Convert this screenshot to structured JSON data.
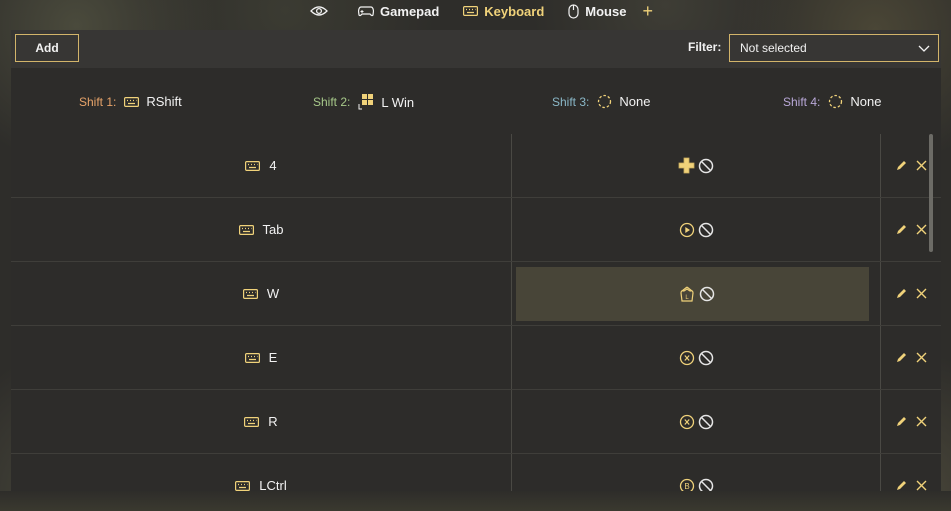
{
  "tabs": {
    "items": [
      {
        "label": "",
        "icon": "eye-icon"
      },
      {
        "label": "Gamepad",
        "icon": "gamepad-icon"
      },
      {
        "label": "Keyboard",
        "icon": "keyboard-icon",
        "active": true
      },
      {
        "label": "Mouse",
        "icon": "mouse-icon"
      }
    ],
    "plus": "+"
  },
  "toolbar": {
    "add_label": "Add",
    "filter_label": "Filter:",
    "filter_value": "Not selected"
  },
  "shifts": [
    {
      "label": "Shift 1:",
      "value": "RShift",
      "icon": "keyboard-icon",
      "color": "#e8a46a"
    },
    {
      "label": "Shift 2:",
      "value": "L Win",
      "icon": "windows-icon",
      "color": "#a7c98a"
    },
    {
      "label": "Shift 3:",
      "value": "None",
      "icon": "dashed-circle-icon",
      "color": "#8ab8c8"
    },
    {
      "label": "Shift 4:",
      "value": "None",
      "icon": "dashed-circle-icon",
      "color": "#b9a8d8"
    }
  ],
  "rows": [
    {
      "key": "4",
      "mapping_icon": "dpad-icon"
    },
    {
      "key": "Tab",
      "mapping_icon": "start-button-icon"
    },
    {
      "key": "W",
      "mapping_icon": "left-stick-up-icon",
      "selected": true
    },
    {
      "key": "E",
      "mapping_icon": "x-button-icon"
    },
    {
      "key": "R",
      "mapping_icon": "x-button-icon"
    },
    {
      "key": "LCtrl",
      "mapping_icon": "b-button-icon"
    }
  ],
  "colors": {
    "accent": "#f0d27a",
    "border": "#d2b46a",
    "background": "#2d2c2a"
  }
}
